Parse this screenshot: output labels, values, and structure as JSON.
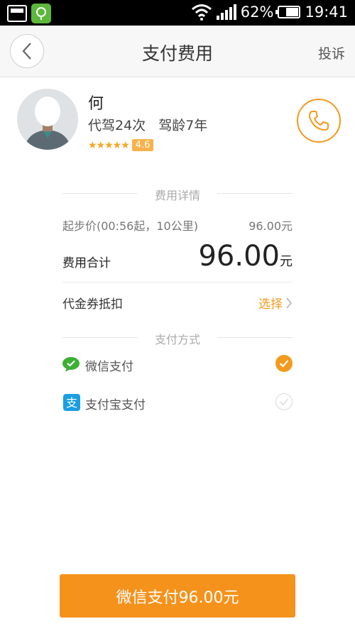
{
  "status_bar": {
    "battery_percent": "62%",
    "battery_level": 0.62,
    "time": "19:41",
    "icons": [
      "screenshot-icon",
      "app-notification-icon",
      "wifi-icon",
      "signal-icon",
      "battery-icon"
    ]
  },
  "header": {
    "title": "支付费用",
    "complain_label": "投诉",
    "back_icon": "chevron-left-icon"
  },
  "driver": {
    "name": "何",
    "trips": "代驾24次",
    "experience": "驾龄7年",
    "stars": "★★★★★",
    "rating": "4.6",
    "call_icon": "phone-icon"
  },
  "fee": {
    "section_title": "费用详情",
    "base_label": "起步价(00:56起，10公里)",
    "base_value": "96.00元",
    "total_label": "费用合计",
    "total_amount": "96.00",
    "total_unit": "元",
    "coupon_label": "代金券抵扣",
    "coupon_action": "选择"
  },
  "payment": {
    "section_title": "支付方式",
    "methods": [
      {
        "label": "微信支付",
        "icon": "wechat-icon",
        "selected": true
      },
      {
        "label": "支付宝支付",
        "icon": "alipay-icon",
        "selected": false
      }
    ]
  },
  "pay_button_label": "微信支付96.00元",
  "colors": {
    "accent": "#f5921c",
    "wechat": "#3cb034",
    "alipay": "#1a9ee2"
  }
}
